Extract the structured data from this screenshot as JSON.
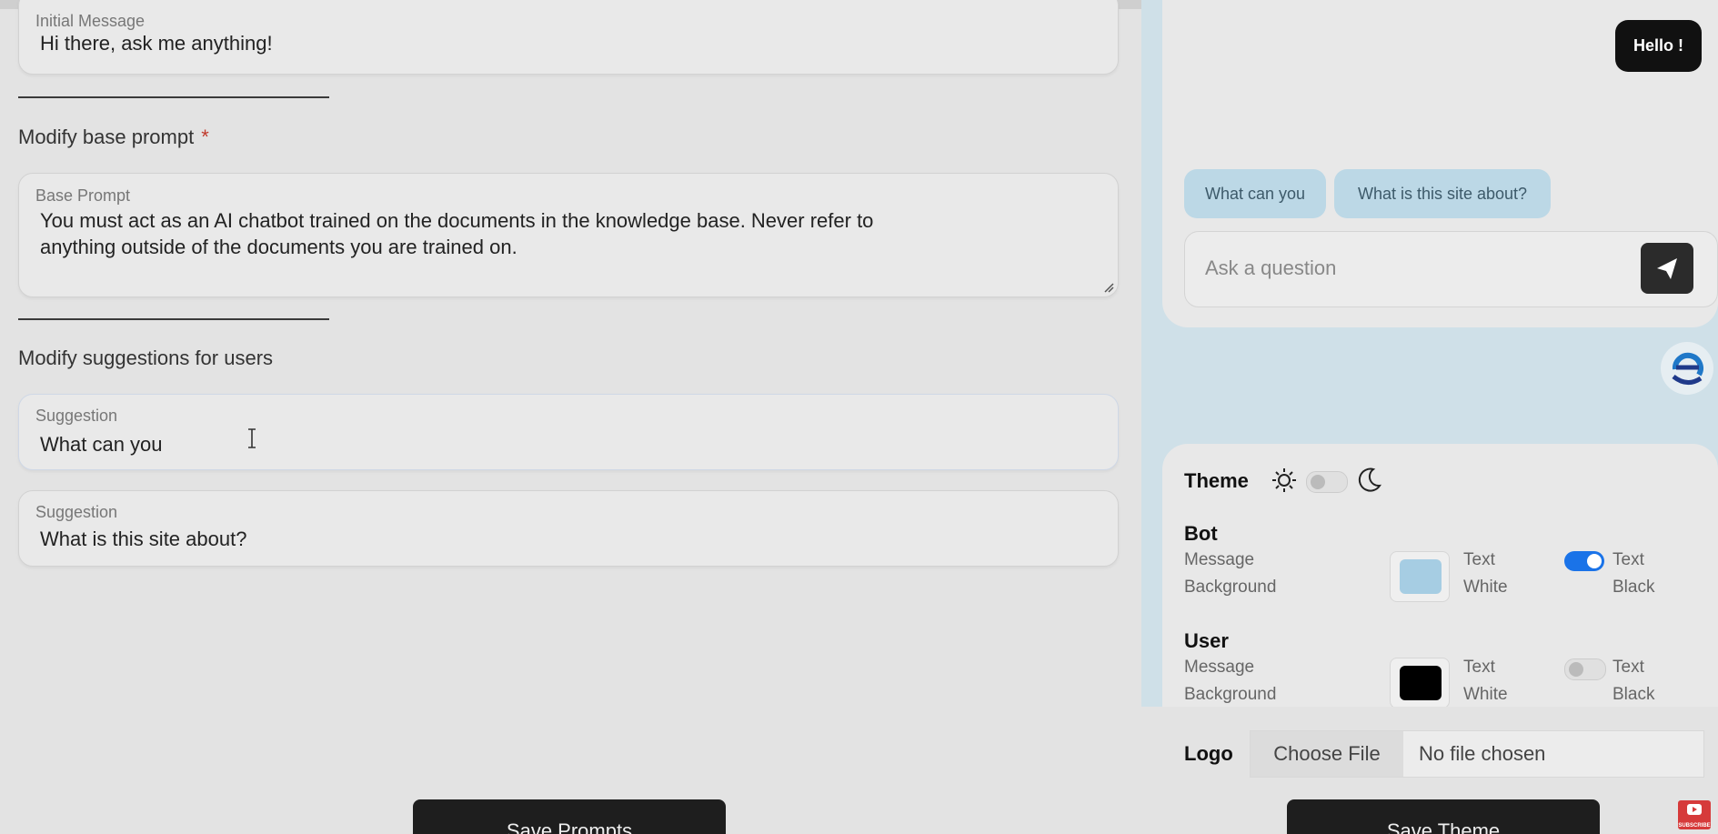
{
  "prompts": {
    "initial_message": {
      "label": "Initial Message",
      "value": "Hi there, ask me anything!"
    },
    "base_prompt_section": "Modify base prompt",
    "required_mark": "*",
    "base_prompt": {
      "label": "Base Prompt",
      "line1": "You must act as an AI chatbot trained on the documents in the knowledge base. Never refer to",
      "line2": "anything outside of the documents you are trained on."
    },
    "suggestions_section": "Modify suggestions for users",
    "suggestions": [
      {
        "label": "Suggestion",
        "value": "What can you"
      },
      {
        "label": "Suggestion",
        "value": "What is this site about?"
      }
    ],
    "save_label": "Save Prompts"
  },
  "preview": {
    "bot_greeting": "Hello !",
    "chips": [
      "What can you",
      "What is this site about?"
    ],
    "ask_placeholder": "Ask a question"
  },
  "theme": {
    "title": "Theme",
    "dark_mode_on": false,
    "bot": {
      "title": "Bot",
      "bg_label_line1": "Message",
      "bg_label_line2": "Background",
      "color": "#a6cde3",
      "text_white_line1": "Text",
      "text_white_line2": "White",
      "text_black_line1": "Text",
      "text_black_line2": "Black",
      "text_black_on": true
    },
    "user": {
      "title": "User",
      "bg_label_line1": "Message",
      "bg_label_line2": "Background",
      "color": "#000000",
      "text_white_line1": "Text",
      "text_white_line2": "White",
      "text_black_line1": "Text",
      "text_black_line2": "Black",
      "text_black_on": false
    },
    "logo_label": "Logo",
    "choose_file": "Choose File",
    "no_file": "No file chosen",
    "save_label": "Save Theme"
  },
  "colors": {
    "accent_blue": "#1a73e8",
    "chip_bg": "#bcd8e6",
    "preview_bg": "#cfe0e8"
  },
  "overlay": {
    "youtube_label": "SUBSCRIBE"
  }
}
